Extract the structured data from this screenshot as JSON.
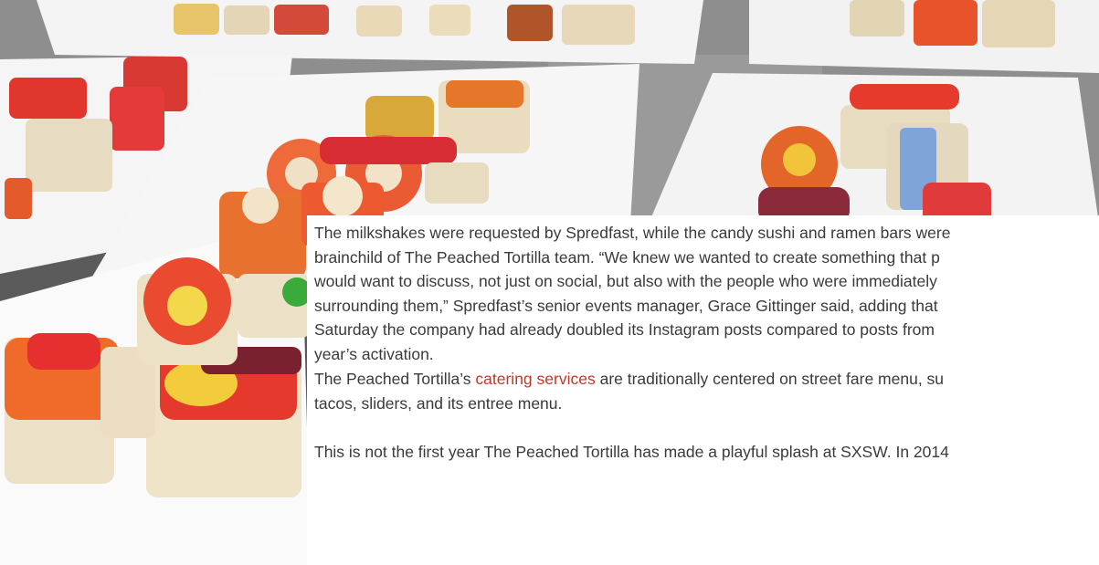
{
  "article": {
    "paragraph1": {
      "lines": [
        "The milkshakes were requested by Spredfast, while the candy sushi and ramen bars were",
        "brainchild of The Peached Tortilla team. “We knew we wanted to create something that p",
        "would want to discuss, not just on social, but also with the people who were immediately",
        "surrounding them,” Spredfast’s senior events manager, Grace Gittinger said, adding that",
        "Saturday the company had already doubled its Instagram posts compared to posts from",
        "year’s activation."
      ]
    },
    "paragraph2": {
      "before_link": "The Peached Tortilla’s ",
      "link_text": "catering services",
      "after_link": " are traditionally centered on street fare menu, su",
      "line2": "tacos, sliders, and its entree menu."
    },
    "paragraph3": {
      "line1": "This is not the first year The Peached Tortilla has made a playful splash at SXSW. In 2014"
    }
  },
  "colors": {
    "body_text": "#3a3a3a",
    "link": "#c0392b",
    "background": "#ffffff"
  }
}
